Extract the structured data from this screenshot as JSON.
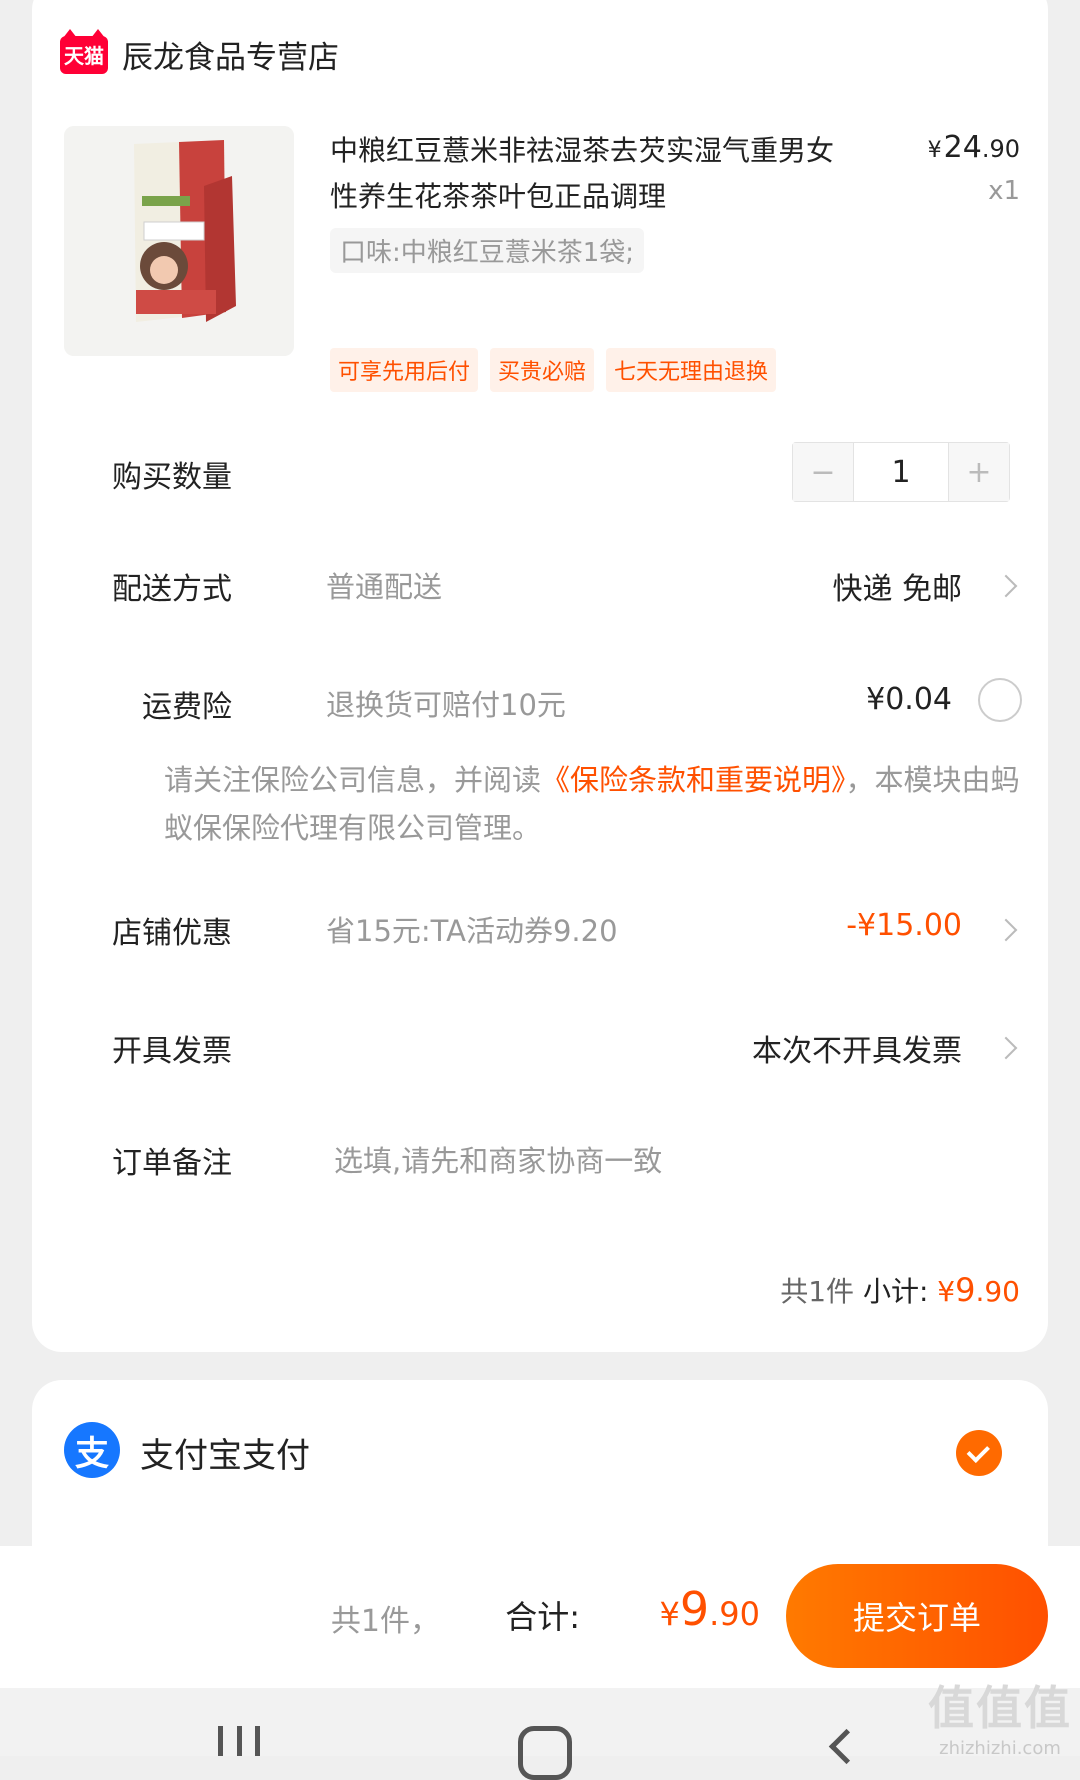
{
  "shop": {
    "logo_text": "天猫",
    "name": "辰龙食品专营店"
  },
  "product": {
    "title": "中粮红豆薏米非祛湿茶去芡实湿气重男女性养生花茶茶叶包正品调理",
    "price_symbol": "¥",
    "price_int": "24",
    "price_dec": ".90",
    "quantity_text": "x1",
    "sku": "口味:中粮红豆薏米茶1袋;",
    "badges": [
      "可享先用后付",
      "买贵必赔",
      "七天无理由退换"
    ]
  },
  "quantity": {
    "label": "购买数量",
    "minus": "−",
    "value": "1",
    "plus": "+"
  },
  "delivery": {
    "label": "配送方式",
    "desc": "普通配送",
    "value": "快递 免邮"
  },
  "shipping_insurance": {
    "label": "运费险",
    "desc": "退换货可赔付10元",
    "value": "¥0.04"
  },
  "notice": {
    "text_before": "请关注保险公司信息，并阅读",
    "link": "《保险条款和重要说明》",
    "text_after": "，本模块由蚂蚁保保险代理有限公司管理。"
  },
  "shop_discount": {
    "label": "店铺优惠",
    "desc": "省15元:TA活动券9.20",
    "value": "-¥15.00"
  },
  "invoice": {
    "label": "开具发票",
    "value": "本次不开具发票"
  },
  "order_note": {
    "label": "订单备注",
    "placeholder": "选填,请先和商家协商一致"
  },
  "subtotal": {
    "count": "共1件",
    "label": "小计:",
    "symbol": "¥",
    "int": "9",
    "dec": ".90"
  },
  "payment": {
    "icon_text": "支",
    "label": "支付宝支付"
  },
  "bottom_bar": {
    "count": "共1件，",
    "label": "合计:",
    "symbol": "¥",
    "int": "9",
    "dec": ".90",
    "submit_label": "提交订单"
  },
  "watermark": {
    "big": "值值值",
    "small": "zhizhizhi.com"
  },
  "colors": {
    "accent": "#ff5000",
    "tmall_red": "#ff0036",
    "alipay_blue": "#1677ff"
  }
}
